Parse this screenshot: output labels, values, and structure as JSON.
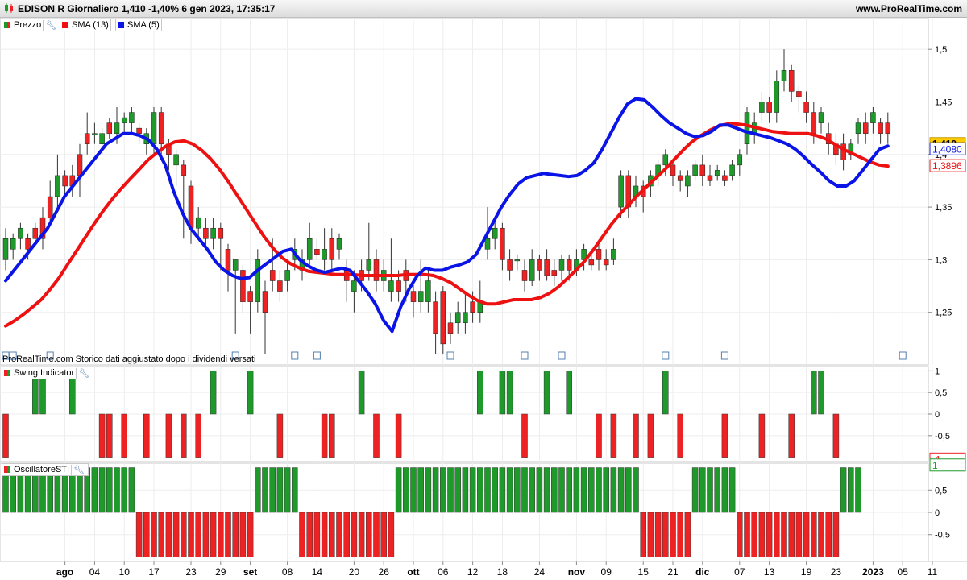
{
  "header": {
    "title": "EDISON R Giornaliero 1,410 -1,40% 6 gen 2023, 17:35:17",
    "site": "www.ProRealTime.com"
  },
  "notice": "ProRealTime.com Storico dati aggiustato dopo i dividendi versati",
  "legend": {
    "price": "Prezzo",
    "sma13": "SMA (13)",
    "sma5": "SMA (5)",
    "swing": "Swing Indicator",
    "osc": "OscillatoreSTI"
  },
  "colors": {
    "up": "#1e9a2a",
    "down": "#ee2222",
    "sma13": "#ee1111",
    "sma5": "#0a14e6",
    "last": "#ffcc00"
  },
  "price_labels": {
    "last": "1,410",
    "sma5": "1,4080",
    "sma13": "1,3896"
  },
  "swing_labels": {
    "top": "1",
    "bottom": "-1"
  },
  "osc_label": "1",
  "chart_data": [
    {
      "type": "candlestick",
      "title": "EDISON R Giornaliero",
      "ylim": [
        1.2,
        1.53
      ],
      "yticks": [
        "1,25",
        "1,3",
        "1,35",
        "1,4",
        "1,45",
        "1,5"
      ],
      "ytick_values": [
        1.25,
        1.3,
        1.35,
        1.4,
        1.45,
        1.5
      ],
      "xticks": [
        {
          "i": 8,
          "label": "ago",
          "bold": true
        },
        {
          "i": 12,
          "label": "04"
        },
        {
          "i": 16,
          "label": "10"
        },
        {
          "i": 20,
          "label": "17"
        },
        {
          "i": 25,
          "label": "23"
        },
        {
          "i": 29,
          "label": "29"
        },
        {
          "i": 33,
          "label": "set",
          "bold": true
        },
        {
          "i": 38,
          "label": "08"
        },
        {
          "i": 42,
          "label": "14"
        },
        {
          "i": 47,
          "label": "20"
        },
        {
          "i": 51,
          "label": "26"
        },
        {
          "i": 55,
          "label": "ott",
          "bold": true
        },
        {
          "i": 59,
          "label": "06"
        },
        {
          "i": 63,
          "label": "12"
        },
        {
          "i": 67,
          "label": "18"
        },
        {
          "i": 72,
          "label": "24"
        },
        {
          "i": 77,
          "label": "nov",
          "bold": true
        },
        {
          "i": 81,
          "label": "09"
        },
        {
          "i": 86,
          "label": "15"
        },
        {
          "i": 90,
          "label": "21"
        },
        {
          "i": 94,
          "label": "dic",
          "bold": true
        },
        {
          "i": 99,
          "label": "07"
        },
        {
          "i": 103,
          "label": "13"
        },
        {
          "i": 108,
          "label": "19"
        },
        {
          "i": 112,
          "label": "23"
        },
        {
          "i": 117,
          "label": "2023",
          "bold": true
        },
        {
          "i": 121,
          "label": "05"
        },
        {
          "i": 125,
          "label": "11"
        }
      ],
      "candles": [
        [
          1.3,
          1.32,
          1.33,
          1.29
        ],
        [
          1.31,
          1.32,
          1.325,
          1.3
        ],
        [
          1.32,
          1.33,
          1.335,
          1.31
        ],
        [
          1.32,
          1.31,
          1.325,
          1.3
        ],
        [
          1.33,
          1.32,
          1.335,
          1.315
        ],
        [
          1.34,
          1.32,
          1.35,
          1.31
        ],
        [
          1.36,
          1.34,
          1.375,
          1.335
        ],
        [
          1.36,
          1.38,
          1.4,
          1.35
        ],
        [
          1.38,
          1.37,
          1.385,
          1.36
        ],
        [
          1.38,
          1.37,
          1.39,
          1.36
        ],
        [
          1.4,
          1.38,
          1.41,
          1.36
        ],
        [
          1.42,
          1.41,
          1.44,
          1.4
        ],
        [
          1.42,
          1.42,
          1.43,
          1.41
        ],
        [
          1.41,
          1.42,
          1.425,
          1.4
        ],
        [
          1.43,
          1.42,
          1.435,
          1.415
        ],
        [
          1.42,
          1.43,
          1.445,
          1.41
        ],
        [
          1.43,
          1.435,
          1.44,
          1.42
        ],
        [
          1.43,
          1.44,
          1.445,
          1.42
        ],
        [
          1.425,
          1.42,
          1.43,
          1.41
        ],
        [
          1.41,
          1.42,
          1.425,
          1.4
        ],
        [
          1.41,
          1.44,
          1.445,
          1.4
        ],
        [
          1.44,
          1.41,
          1.445,
          1.4
        ],
        [
          1.41,
          1.4,
          1.415,
          1.385
        ],
        [
          1.39,
          1.4,
          1.405,
          1.37
        ],
        [
          1.39,
          1.38,
          1.395,
          1.32
        ],
        [
          1.37,
          1.33,
          1.375,
          1.315
        ],
        [
          1.33,
          1.34,
          1.35,
          1.32
        ],
        [
          1.33,
          1.32,
          1.34,
          1.31
        ],
        [
          1.32,
          1.33,
          1.34,
          1.31
        ],
        [
          1.33,
          1.32,
          1.335,
          1.29
        ],
        [
          1.31,
          1.29,
          1.315,
          1.27
        ],
        [
          1.29,
          1.3,
          1.3,
          1.23
        ],
        [
          1.29,
          1.26,
          1.295,
          1.25
        ],
        [
          1.27,
          1.26,
          1.275,
          1.23
        ],
        [
          1.26,
          1.3,
          1.31,
          1.25
        ],
        [
          1.27,
          1.25,
          1.28,
          1.21
        ],
        [
          1.29,
          1.28,
          1.32,
          1.27
        ],
        [
          1.28,
          1.27,
          1.29,
          1.26
        ],
        [
          1.28,
          1.29,
          1.3,
          1.27
        ],
        [
          1.3,
          1.31,
          1.32,
          1.29
        ],
        [
          1.29,
          1.3,
          1.31,
          1.28
        ],
        [
          1.3,
          1.32,
          1.335,
          1.295
        ],
        [
          1.31,
          1.305,
          1.32,
          1.3
        ],
        [
          1.3,
          1.31,
          1.33,
          1.29
        ],
        [
          1.32,
          1.3,
          1.33,
          1.29
        ],
        [
          1.31,
          1.32,
          1.325,
          1.3
        ],
        [
          1.29,
          1.28,
          1.3,
          1.26
        ],
        [
          1.27,
          1.28,
          1.29,
          1.25
        ],
        [
          1.29,
          1.28,
          1.3,
          1.27
        ],
        [
          1.29,
          1.3,
          1.335,
          1.28
        ],
        [
          1.3,
          1.28,
          1.31,
          1.27
        ],
        [
          1.28,
          1.29,
          1.3,
          1.27
        ],
        [
          1.27,
          1.28,
          1.32,
          1.26
        ],
        [
          1.28,
          1.27,
          1.29,
          1.26
        ],
        [
          1.29,
          1.28,
          1.3,
          1.26
        ],
        [
          1.27,
          1.26,
          1.28,
          1.245
        ],
        [
          1.26,
          1.27,
          1.3,
          1.25
        ],
        [
          1.26,
          1.28,
          1.29,
          1.25
        ],
        [
          1.26,
          1.23,
          1.27,
          1.21
        ],
        [
          1.27,
          1.22,
          1.275,
          1.21
        ],
        [
          1.24,
          1.23,
          1.25,
          1.22
        ],
        [
          1.24,
          1.25,
          1.26,
          1.23
        ],
        [
          1.24,
          1.25,
          1.27,
          1.23
        ],
        [
          1.26,
          1.25,
          1.27,
          1.24
        ],
        [
          1.25,
          1.26,
          1.28,
          1.24
        ],
        [
          1.31,
          1.32,
          1.35,
          1.3
        ],
        [
          1.32,
          1.33,
          1.34,
          1.31
        ],
        [
          1.33,
          1.3,
          1.335,
          1.29
        ],
        [
          1.3,
          1.29,
          1.31,
          1.28
        ],
        [
          1.3,
          1.3,
          1.305,
          1.29
        ],
        [
          1.29,
          1.28,
          1.3,
          1.27
        ],
        [
          1.28,
          1.3,
          1.31,
          1.275
        ],
        [
          1.3,
          1.29,
          1.305,
          1.28
        ],
        [
          1.3,
          1.285,
          1.31,
          1.28
        ],
        [
          1.29,
          1.285,
          1.3,
          1.275
        ],
        [
          1.29,
          1.3,
          1.305,
          1.28
        ],
        [
          1.3,
          1.29,
          1.305,
          1.28
        ],
        [
          1.29,
          1.3,
          1.31,
          1.285
        ],
        [
          1.3,
          1.31,
          1.315,
          1.29
        ],
        [
          1.3,
          1.295,
          1.31,
          1.29
        ],
        [
          1.31,
          1.3,
          1.315,
          1.29
        ],
        [
          1.3,
          1.295,
          1.31,
          1.29
        ],
        [
          1.3,
          1.31,
          1.32,
          1.295
        ],
        [
          1.35,
          1.38,
          1.385,
          1.34
        ],
        [
          1.38,
          1.35,
          1.385,
          1.34
        ],
        [
          1.36,
          1.37,
          1.38,
          1.35
        ],
        [
          1.37,
          1.36,
          1.375,
          1.345
        ],
        [
          1.37,
          1.38,
          1.385,
          1.36
        ],
        [
          1.38,
          1.39,
          1.395,
          1.37
        ],
        [
          1.39,
          1.4,
          1.405,
          1.38
        ],
        [
          1.39,
          1.38,
          1.395,
          1.37
        ],
        [
          1.38,
          1.375,
          1.385,
          1.365
        ],
        [
          1.37,
          1.38,
          1.385,
          1.36
        ],
        [
          1.38,
          1.39,
          1.395,
          1.375
        ],
        [
          1.39,
          1.38,
          1.4,
          1.37
        ],
        [
          1.38,
          1.375,
          1.39,
          1.37
        ],
        [
          1.38,
          1.385,
          1.39,
          1.375
        ],
        [
          1.38,
          1.375,
          1.385,
          1.37
        ],
        [
          1.38,
          1.39,
          1.395,
          1.375
        ],
        [
          1.39,
          1.4,
          1.405,
          1.38
        ],
        [
          1.41,
          1.44,
          1.445,
          1.4
        ],
        [
          1.42,
          1.43,
          1.44,
          1.41
        ],
        [
          1.44,
          1.45,
          1.46,
          1.43
        ],
        [
          1.45,
          1.44,
          1.455,
          1.43
        ],
        [
          1.44,
          1.47,
          1.48,
          1.43
        ],
        [
          1.47,
          1.48,
          1.5,
          1.46
        ],
        [
          1.48,
          1.46,
          1.485,
          1.45
        ],
        [
          1.46,
          1.455,
          1.465,
          1.44
        ],
        [
          1.45,
          1.44,
          1.46,
          1.43
        ],
        [
          1.44,
          1.42,
          1.45,
          1.41
        ],
        [
          1.43,
          1.44,
          1.445,
          1.42
        ],
        [
          1.42,
          1.41,
          1.43,
          1.4
        ],
        [
          1.41,
          1.4,
          1.42,
          1.39
        ],
        [
          1.41,
          1.395,
          1.42,
          1.385
        ],
        [
          1.4,
          1.41,
          1.415,
          1.395
        ],
        [
          1.42,
          1.43,
          1.435,
          1.41
        ],
        [
          1.43,
          1.42,
          1.44,
          1.41
        ],
        [
          1.43,
          1.44,
          1.445,
          1.42
        ],
        [
          1.43,
          1.42,
          1.435,
          1.41
        ],
        [
          1.43,
          1.42,
          1.44,
          1.41
        ]
      ],
      "sma13": [
        1.237,
        1.242,
        1.248,
        1.255,
        1.262,
        1.272,
        1.283,
        1.296,
        1.309,
        1.322,
        1.335,
        1.347,
        1.358,
        1.368,
        1.377,
        1.386,
        1.395,
        1.402,
        1.408,
        1.412,
        1.413,
        1.41,
        1.404,
        1.396,
        1.386,
        1.374,
        1.361,
        1.348,
        1.335,
        1.322,
        1.311,
        1.302,
        1.296,
        1.292,
        1.289,
        1.288,
        1.287,
        1.286,
        1.286,
        1.286,
        1.285,
        1.285,
        1.285,
        1.285,
        1.285,
        1.286,
        1.286,
        1.286,
        1.285,
        1.282,
        1.278,
        1.272,
        1.266,
        1.261,
        1.258,
        1.258,
        1.26,
        1.262,
        1.262,
        1.262,
        1.264,
        1.268,
        1.274,
        1.282,
        1.29,
        1.299,
        1.31,
        1.322,
        1.334,
        1.344,
        1.353,
        1.362,
        1.37,
        1.378,
        1.386,
        1.395,
        1.404,
        1.412,
        1.418,
        1.423,
        1.427,
        1.429,
        1.429,
        1.428,
        1.426,
        1.424,
        1.422,
        1.421,
        1.42,
        1.42,
        1.42,
        1.418,
        1.415,
        1.41,
        1.405,
        1.401,
        1.397,
        1.393,
        1.39,
        1.389
      ],
      "sma5": [
        1.28,
        1.29,
        1.3,
        1.31,
        1.32,
        1.33,
        1.345,
        1.36,
        1.37,
        1.38,
        1.39,
        1.4,
        1.41,
        1.415,
        1.42,
        1.42,
        1.418,
        1.414,
        1.405,
        1.39,
        1.365,
        1.345,
        1.33,
        1.32,
        1.31,
        1.298,
        1.29,
        1.285,
        1.282,
        1.283,
        1.29,
        1.296,
        1.302,
        1.308,
        1.31,
        1.3,
        1.294,
        1.29,
        1.288,
        1.29,
        1.292,
        1.29,
        1.28,
        1.27,
        1.258,
        1.242,
        1.232,
        1.255,
        1.272,
        1.285,
        1.292,
        1.29,
        1.29,
        1.293,
        1.295,
        1.298,
        1.305,
        1.32,
        1.335,
        1.35,
        1.362,
        1.372,
        1.378,
        1.38,
        1.382,
        1.381,
        1.38,
        1.379,
        1.38,
        1.385,
        1.392,
        1.405,
        1.42,
        1.435,
        1.448,
        1.453,
        1.452,
        1.445,
        1.437,
        1.43,
        1.425,
        1.42,
        1.417,
        1.418,
        1.422,
        1.428,
        1.428,
        1.425,
        1.422,
        1.42,
        1.418,
        1.416,
        1.413,
        1.41,
        1.405,
        1.398,
        1.39,
        1.383,
        1.375,
        1.37,
        1.37,
        1.375,
        1.385,
        1.395,
        1.405,
        1.408
      ]
    },
    {
      "type": "bar",
      "title": "Swing Indicator",
      "ylim": [
        -1.1,
        1.1
      ],
      "yticks": [
        "1",
        "0,5",
        "0",
        "-0,5"
      ],
      "ytick_values": [
        1,
        0.5,
        0,
        -0.5
      ],
      "values": [
        -1,
        0,
        0,
        0,
        1,
        1,
        0,
        0,
        0,
        1,
        0,
        0,
        0,
        -1,
        -1,
        0,
        -1,
        0,
        0,
        -1,
        0,
        0,
        -1,
        0,
        -1,
        0,
        -1,
        0,
        1,
        0,
        0,
        0,
        0,
        1,
        0,
        0,
        0,
        -1,
        0,
        0,
        0,
        0,
        0,
        -1,
        -1,
        0,
        0,
        0,
        1,
        0,
        -1,
        0,
        0,
        -1,
        0,
        0,
        0,
        0,
        0,
        0,
        0,
        0,
        0,
        0,
        1,
        0,
        0,
        1,
        1,
        0,
        -1,
        0,
        0,
        1,
        0,
        0,
        1,
        0,
        0,
        0,
        -1,
        0,
        -1,
        0,
        0,
        -1,
        0,
        -1,
        0,
        1,
        0,
        -1,
        0,
        0,
        0,
        0,
        0,
        -1,
        0,
        0,
        0,
        0,
        -1,
        0,
        0,
        0,
        -1,
        0,
        0,
        1,
        1,
        0,
        -1
      ]
    },
    {
      "type": "bar",
      "title": "OscillatoreSTI",
      "ylim": [
        -1.1,
        1.1
      ],
      "yticks": [
        "0,5",
        "0",
        "-0,5"
      ],
      "ytick_values": [
        0.5,
        0,
        -0.5
      ],
      "values": [
        1,
        1,
        1,
        1,
        1,
        1,
        1,
        1,
        1,
        1,
        1,
        1,
        1,
        1,
        1,
        1,
        1,
        1,
        -1,
        -1,
        -1,
        -1,
        -1,
        -1,
        -1,
        -1,
        -1,
        -1,
        -1,
        -1,
        -1,
        -1,
        -1,
        -1,
        1,
        1,
        1,
        1,
        1,
        1,
        -1,
        -1,
        -1,
        -1,
        -1,
        -1,
        -1,
        -1,
        -1,
        -1,
        -1,
        -1,
        -1,
        1,
        1,
        1,
        1,
        1,
        1,
        1,
        1,
        1,
        1,
        1,
        1,
        1,
        1,
        1,
        1,
        1,
        1,
        1,
        1,
        1,
        1,
        1,
        1,
        1,
        1,
        1,
        1,
        1,
        1,
        1,
        1,
        1,
        -1,
        -1,
        -1,
        -1,
        -1,
        -1,
        -1,
        1,
        1,
        1,
        1,
        1,
        1,
        -1,
        -1,
        -1,
        -1,
        -1,
        -1,
        -1,
        -1,
        -1,
        -1,
        -1,
        -1,
        -1,
        -1,
        1,
        1,
        1
      ]
    }
  ]
}
